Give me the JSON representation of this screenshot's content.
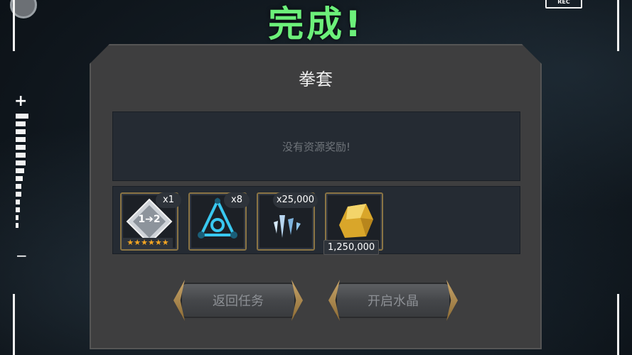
{
  "hud": {
    "rec_label": "REC",
    "zoom_plus": "+",
    "zoom_minus": "−"
  },
  "header": {
    "title": "完成!"
  },
  "panel": {
    "title": "拳套",
    "resources_message": "没有资源奖励!",
    "rewards": [
      {
        "icon": "crystal-upgrade-icon",
        "icon_text": "1➔2",
        "qty": "x1",
        "stars": "★★★★★★"
      },
      {
        "icon": "catalyst-icon",
        "qty": "x8"
      },
      {
        "icon": "shard-icon",
        "qty": "x25,000"
      },
      {
        "icon": "gold-icon",
        "amount": "1,250,000"
      }
    ],
    "buttons": {
      "return": "返回任务",
      "open_crystal": "开启水晶"
    }
  },
  "colors": {
    "title_green": "#6cf07a",
    "gold_frame": "#8a7444",
    "star": "#f5a623"
  }
}
